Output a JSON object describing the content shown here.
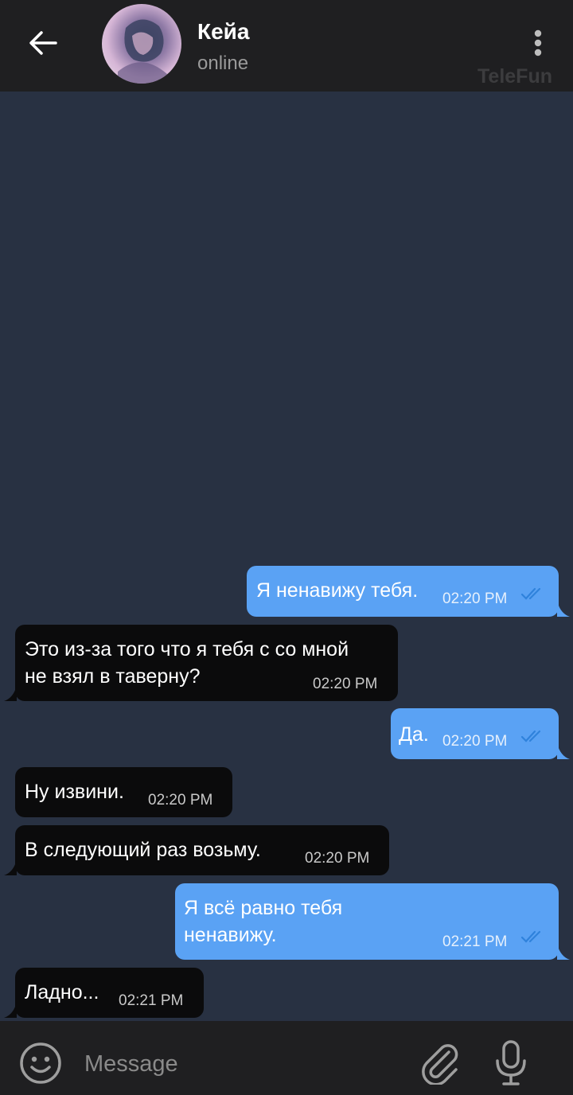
{
  "header": {
    "contact_name": "Кейа",
    "status": "online",
    "watermark": "TeleFun"
  },
  "icons": {
    "back": "back-arrow-icon",
    "menu": "more-vertical-icon",
    "emoji": "emoji-icon",
    "attach": "paperclip-icon",
    "mic": "microphone-icon",
    "read": "double-check-icon"
  },
  "messages": [
    {
      "direction": "outgoing",
      "text": "Я ненавижу тебя.",
      "time": "02:20 PM",
      "read": true
    },
    {
      "direction": "incoming",
      "lines": [
        "Это из-за того что я тебя с со мной",
        "не взял в таверну?"
      ],
      "time": "02:20 PM"
    },
    {
      "direction": "outgoing",
      "text": "Да.",
      "time": "02:20 PM",
      "read": true
    },
    {
      "direction": "incoming",
      "text": "Ну извини.",
      "time": "02:20 PM"
    },
    {
      "direction": "incoming",
      "text": "В следующий раз возьму.",
      "time": "02:20 PM"
    },
    {
      "direction": "outgoing",
      "lines": [
        "Я всё равно тебя",
        "ненавижу."
      ],
      "time": "02:21 PM",
      "read": true
    },
    {
      "direction": "incoming",
      "text": "Ладно...",
      "time": "02:21 PM"
    }
  ],
  "composer": {
    "placeholder": "Message"
  },
  "colors": {
    "chat_background": "#283142",
    "bar_background": "#1f1f21",
    "outgoing_bubble": "#5aa2f4",
    "incoming_bubble": "#0b0b0c",
    "read_tick": "#2f82dc"
  }
}
